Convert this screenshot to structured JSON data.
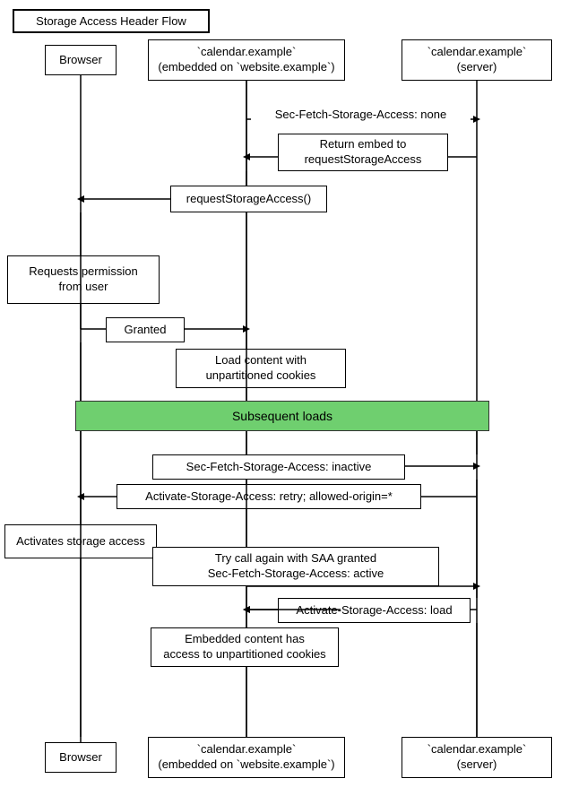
{
  "title": "Storage Access Header Flow",
  "actors": {
    "browser_top": "Browser",
    "calendar_embedded_top": "`calendar.example`\n(embedded on `website.example`)",
    "calendar_server_top": "`calendar.example`\n(server)",
    "browser_bottom": "Browser",
    "calendar_embedded_bottom": "`calendar.example`\n(embedded on `website.example`)",
    "calendar_server_bottom": "`calendar.example`\n(server)"
  },
  "messages": {
    "sec_fetch_none": "Sec-Fetch-Storage-Access: none",
    "return_embed": "Return embed to\nrequestStorageAccess",
    "request_storage_access": "requestStorageAccess()",
    "requests_permission": "Requests permission\nfrom user",
    "granted": "Granted",
    "load_content": "Load content with\nunpartitioned cookies",
    "subsequent_loads": "Subsequent loads",
    "sec_fetch_inactive": "Sec-Fetch-Storage-Access: inactive",
    "activate_retry": "Activate-Storage-Access: retry; allowed-origin=*",
    "activates_storage": "Activates storage access",
    "try_call_again": "Try call again with SAA granted\nSec-Fetch-Storage-Access: active",
    "activate_load": "Activate-Storage-Access: load",
    "embedded_content": "Embedded content has\naccess to unpartitioned cookies"
  }
}
